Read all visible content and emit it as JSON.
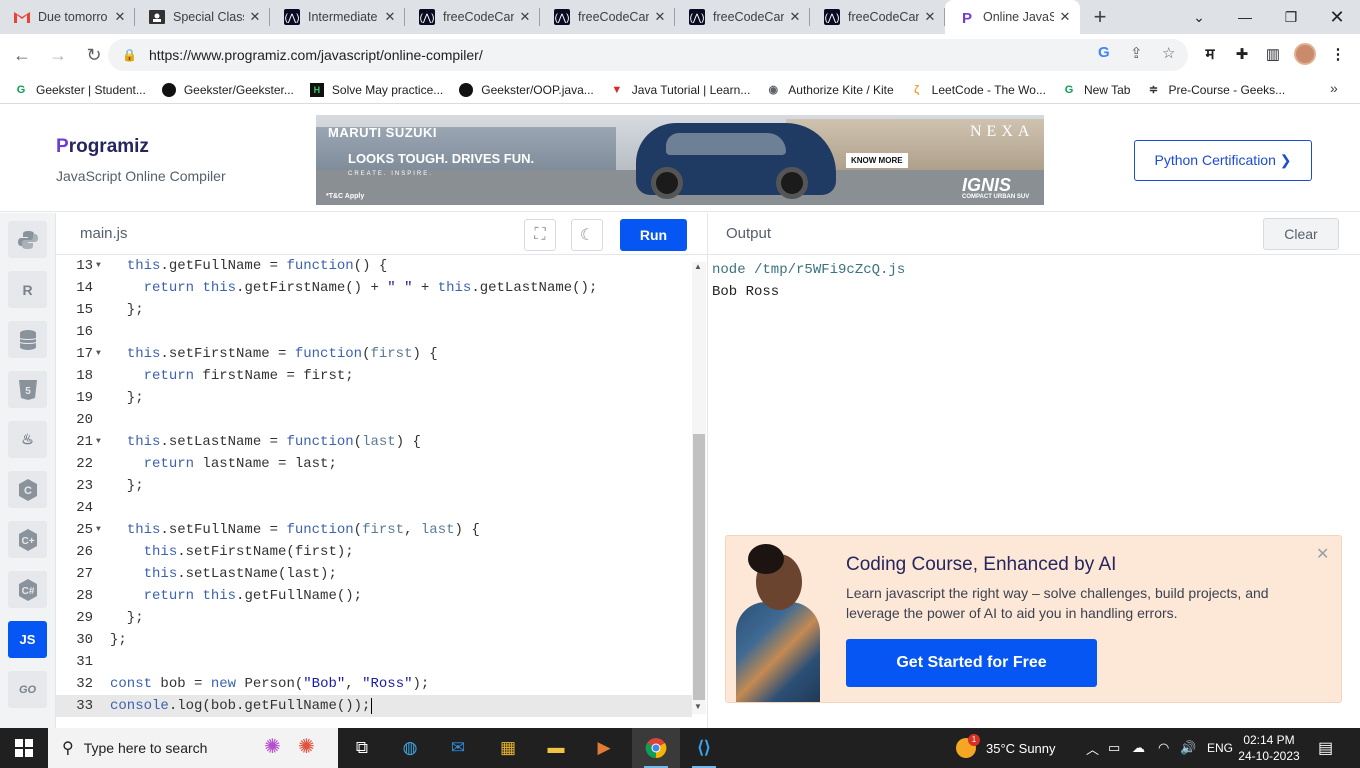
{
  "browser": {
    "tabs": [
      {
        "title": "Due tomorro",
        "icon": "gmail-icon",
        "active": false
      },
      {
        "title": "Special Class",
        "icon": "classroom-icon",
        "active": false
      },
      {
        "title": "Intermediate",
        "icon": "freecodecamp-icon",
        "active": false
      },
      {
        "title": "freeCodeCan",
        "icon": "freecodecamp-icon",
        "active": false
      },
      {
        "title": "freeCodeCan",
        "icon": "freecodecamp-icon",
        "active": false
      },
      {
        "title": "freeCodeCan",
        "icon": "freecodecamp-icon",
        "active": false
      },
      {
        "title": "freeCodeCan",
        "icon": "freecodecamp-icon",
        "active": false
      },
      {
        "title": "Online JavaS",
        "icon": "programiz-icon",
        "active": true
      }
    ],
    "url": "https://www.programiz.com/javascript/online-compiler/",
    "bookmarks": [
      {
        "label": "Geekster | Student...",
        "icon": "geekster-icon"
      },
      {
        "label": "Geekster/Geekster...",
        "icon": "github-icon"
      },
      {
        "label": "Solve May practice...",
        "icon": "hackerrank-icon"
      },
      {
        "label": "Geekster/OOP.java...",
        "icon": "github-icon"
      },
      {
        "label": "Java Tutorial | Learn...",
        "icon": "javatpoint-icon"
      },
      {
        "label": "Authorize Kite / Kite",
        "icon": "kite-icon"
      },
      {
        "label": "LeetCode - The Wo...",
        "icon": "leetcode-icon"
      },
      {
        "label": "New Tab",
        "icon": "geekster-icon"
      },
      {
        "label": "Pre-Course - Geeks...",
        "icon": "precourse-icon"
      }
    ]
  },
  "site": {
    "logo": "rogramiz",
    "logo_p": "P",
    "subtitle": "JavaScript Online Compiler",
    "certification": "Python Certification ❯",
    "ad": {
      "brand": "MARUTI SUZUKI",
      "headline": "LOOKS TOUGH. DRIVES FUN.",
      "tagline": "CREATE. INSPIRE.",
      "terms": "*T&C Apply",
      "nexa": "NEXA",
      "cta": "KNOW MORE",
      "model": "IGNIS",
      "model_sub": "COMPACT URBAN SUV"
    }
  },
  "editor": {
    "file": "main.js",
    "run_label": "Run",
    "lines": [
      {
        "n": "13",
        "fold": true,
        "html": "  <span class=\"k\">this</span>.getFullName = <span class=\"k\">function</span>() {"
      },
      {
        "n": "14",
        "fold": false,
        "html": "    <span class=\"k\">return</span> <span class=\"k\">this</span>.getFirstName() + <span class=\"s\">\" \"</span> + <span class=\"k\">this</span>.getLastName();"
      },
      {
        "n": "15",
        "fold": false,
        "html": "  };"
      },
      {
        "n": "16",
        "fold": false,
        "html": ""
      },
      {
        "n": "17",
        "fold": true,
        "html": "  <span class=\"k\">this</span>.setFirstName = <span class=\"k\">function</span>(<span class=\"p\">first</span>) {"
      },
      {
        "n": "18",
        "fold": false,
        "html": "    <span class=\"k\">return</span> firstName = first;"
      },
      {
        "n": "19",
        "fold": false,
        "html": "  };"
      },
      {
        "n": "20",
        "fold": false,
        "html": ""
      },
      {
        "n": "21",
        "fold": true,
        "html": "  <span class=\"k\">this</span>.setLastName = <span class=\"k\">function</span>(<span class=\"p\">last</span>) {"
      },
      {
        "n": "22",
        "fold": false,
        "html": "    <span class=\"k\">return</span> lastName = last;"
      },
      {
        "n": "23",
        "fold": false,
        "html": "  };"
      },
      {
        "n": "24",
        "fold": false,
        "html": ""
      },
      {
        "n": "25",
        "fold": true,
        "html": "  <span class=\"k\">this</span>.setFullName = <span class=\"k\">function</span>(<span class=\"p\">first</span>, <span class=\"p\">last</span>) {"
      },
      {
        "n": "26",
        "fold": false,
        "html": "    <span class=\"k\">this</span>.setFirstName(first);"
      },
      {
        "n": "27",
        "fold": false,
        "html": "    <span class=\"k\">this</span>.setLastName(last);"
      },
      {
        "n": "28",
        "fold": false,
        "html": "    <span class=\"k\">return</span> <span class=\"k\">this</span>.getFullName();"
      },
      {
        "n": "29",
        "fold": false,
        "html": "  };"
      },
      {
        "n": "30",
        "fold": false,
        "html": "};"
      },
      {
        "n": "31",
        "fold": false,
        "html": ""
      },
      {
        "n": "32",
        "fold": false,
        "html": "<span class=\"k\">const</span> bob = <span class=\"k\">new</span> Person(<span class=\"s\">\"Bob\"</span>, <span class=\"s\">\"Ross\"</span>);"
      },
      {
        "n": "33",
        "fold": false,
        "html": "<span class=\"k\">console</span>.log(bob.getFullName());",
        "current": true
      }
    ]
  },
  "output": {
    "label": "Output",
    "clear_label": "Clear",
    "command": "node /tmp/r5WFi9cZcQ.js",
    "result": "Bob Ross"
  },
  "promo": {
    "title": "Coding Course, Enhanced by AI",
    "description": "Learn javascript the right way – solve challenges, build projects, and leverage the power of AI to aid you in handling errors.",
    "cta": "Get Started for Free"
  },
  "sidebar": {
    "languages": [
      "python",
      "r",
      "sql",
      "html",
      "java",
      "c",
      "cpp",
      "csharp",
      "JS",
      "GO"
    ]
  },
  "taskbar": {
    "search_placeholder": "Type here to search",
    "weather": "35°C  Sunny",
    "lang": "ENG",
    "time": "02:14 PM",
    "date": "24-10-2023",
    "weather_badge": "1"
  }
}
